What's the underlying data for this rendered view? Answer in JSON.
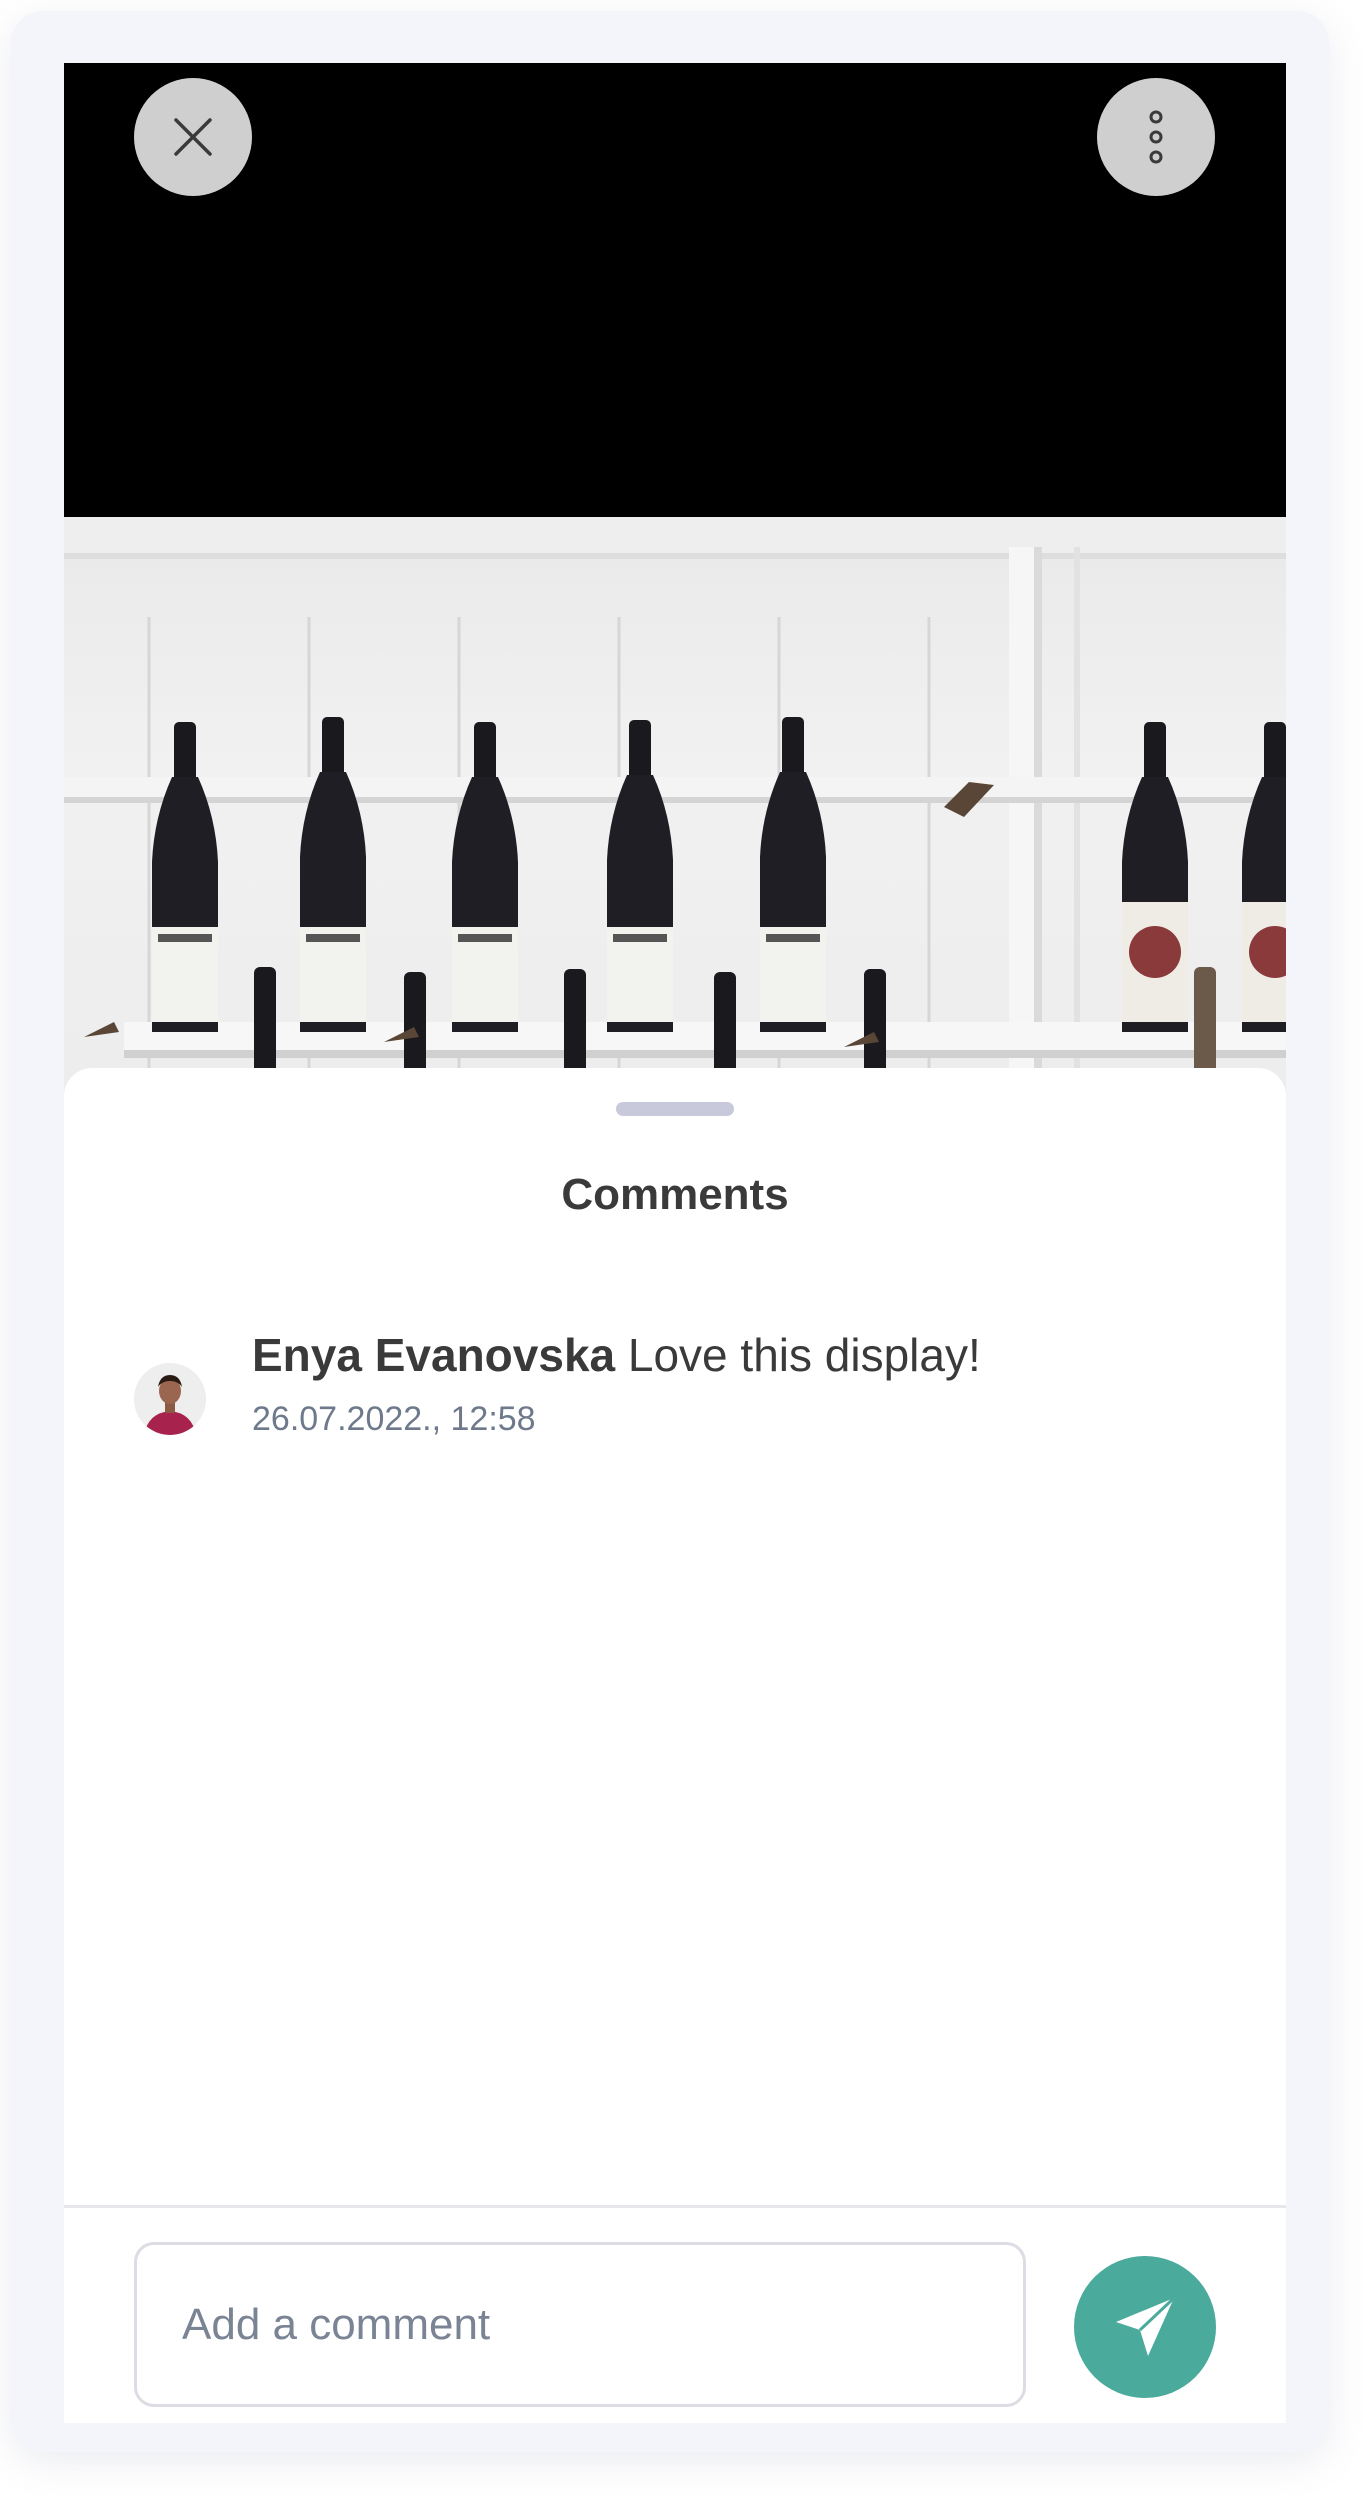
{
  "colors": {
    "accent": "#4aaa9c",
    "overlay_button": "#cfcfcf",
    "title_text": "#3a3a3a",
    "muted_text": "#6e7a8c"
  },
  "toolbar": {
    "close_icon": "close-icon",
    "more_icon": "more-vertical-icon"
  },
  "sheet": {
    "title": "Comments"
  },
  "comments": [
    {
      "author": "Enya Evanovska",
      "text": "Love this display!",
      "timestamp": "26.07.2022., 12:58"
    }
  ],
  "composer": {
    "placeholder": "Add a comment",
    "send_icon": "send-icon"
  }
}
